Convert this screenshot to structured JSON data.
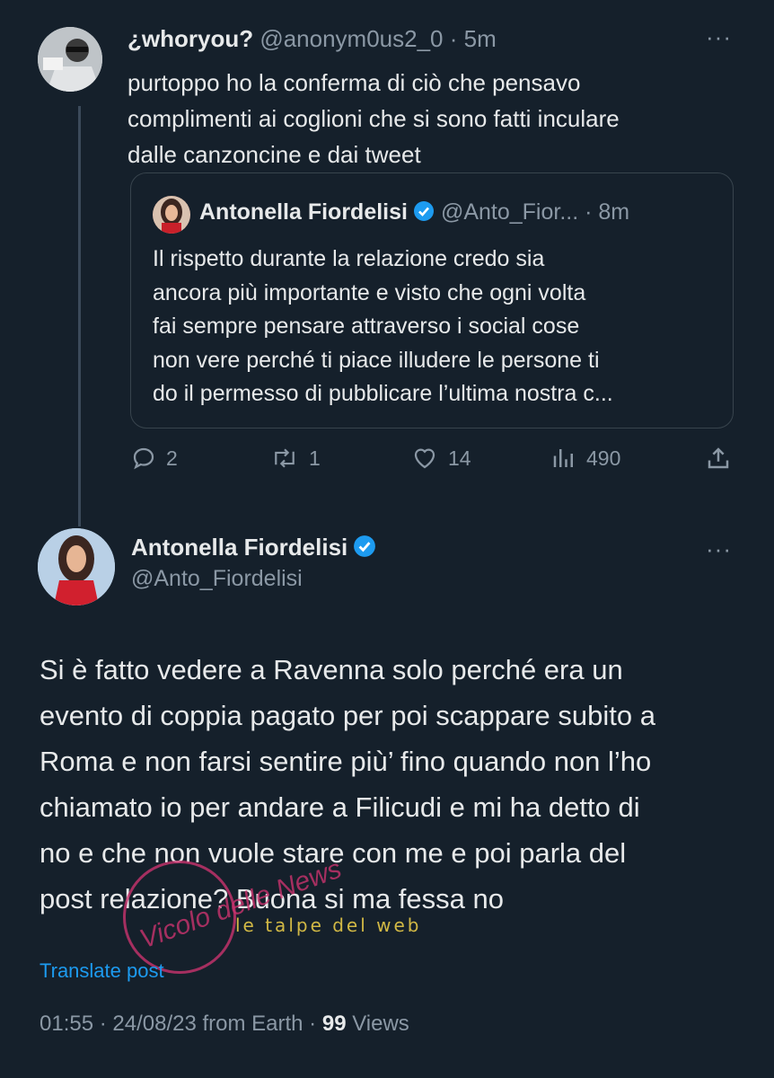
{
  "tweet1": {
    "display_name": "¿whoryou?",
    "handle": "@anonym0us2_0",
    "time": "5m",
    "text_lines": [
      "purtoppo ho la conferma di ciò che pensavo",
      "complimenti ai coglioni che si sono fatti inculare",
      "dalle canzoncine e dai tweet"
    ],
    "quoted": {
      "display_name": "Antonella Fiordelisi",
      "handle": "@Anto_Fior...",
      "time": "8m",
      "text_lines": [
        "Il rispetto durante la relazione credo sia",
        "ancora più importante e visto che ogni volta",
        "fai sempre pensare attraverso i social cose",
        "non vere perché ti piace illudere le persone ti",
        "do il permesso di pubblicare l’ultima nostra c..."
      ]
    },
    "actions": {
      "replies": "2",
      "retweets": "1",
      "likes": "14",
      "views": "490"
    }
  },
  "tweet2": {
    "display_name": "Antonella Fiordelisi",
    "handle": "@Anto_Fiordelisi",
    "text_lines": [
      "Si è fatto vedere a Ravenna solo perché era un",
      "evento di coppia pagato per poi scappare subito a",
      "Roma e non farsi sentire più’ fino quando non l’ho",
      "chiamato io per andare a Filicudi e mi ha detto di",
      "no e che non vuole stare con me e poi parla del",
      "post relazione? Buona si ma fessa no"
    ],
    "translate_label": "Translate post",
    "meta_time": "01:55 · 24/08/23 from Earth ·",
    "views_count": "99",
    "views_label": "Views"
  },
  "watermarks": {
    "left_text": "Vicolo delle News",
    "right_text": "le talpe del web"
  },
  "colors": {
    "background": "#15202b",
    "text": "#e7e9ea",
    "muted": "#8b98a5",
    "accent": "#1d9bf0"
  }
}
